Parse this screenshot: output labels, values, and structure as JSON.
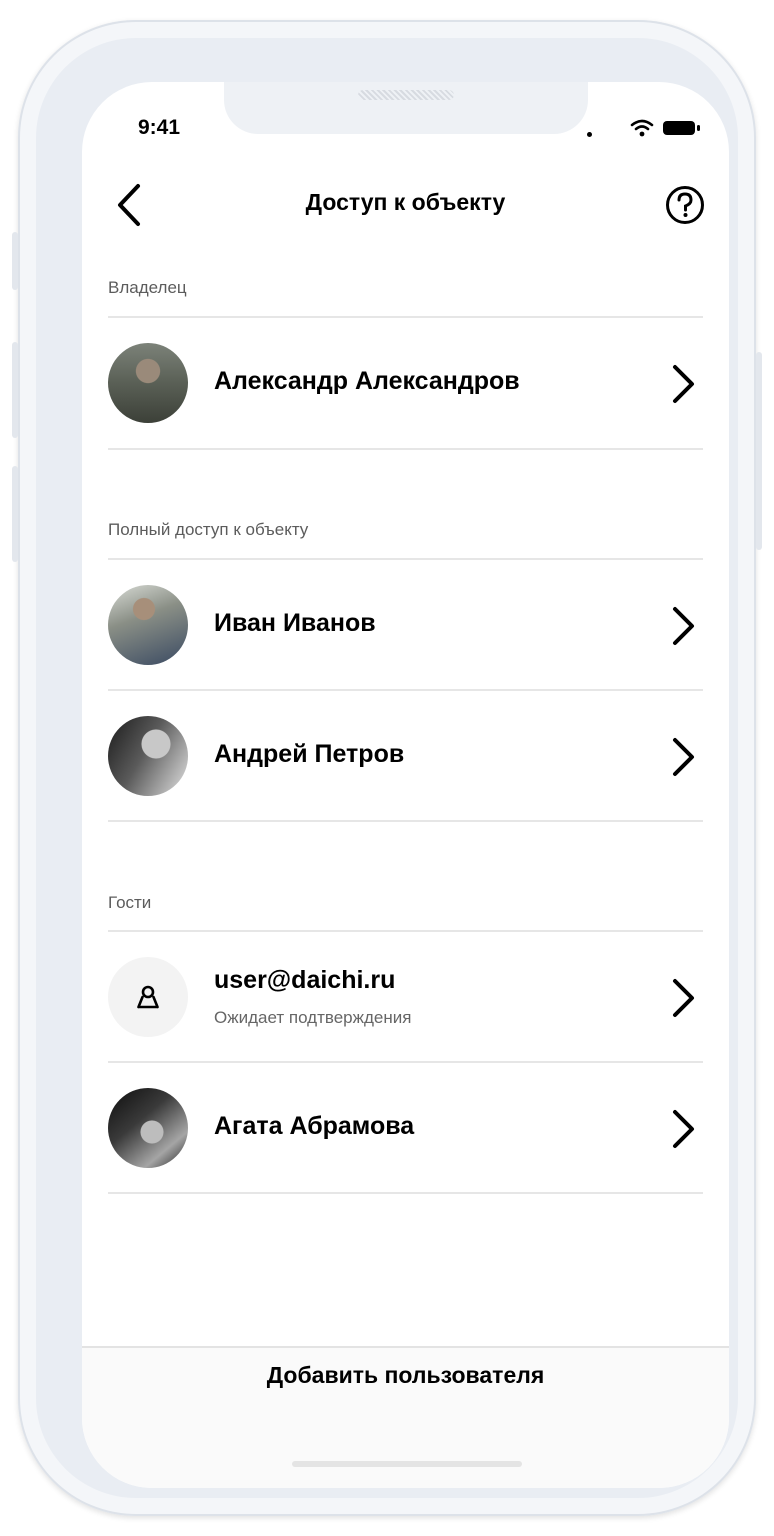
{
  "status_bar": {
    "time": "9:41"
  },
  "header": {
    "title": "Доступ к объекту"
  },
  "sections": {
    "owner": {
      "label": "Владелец"
    },
    "full_access": {
      "label": "Полный доступ к объекту"
    },
    "guests": {
      "label": "Гости"
    }
  },
  "users": {
    "owner": {
      "name": "Александр Александров"
    },
    "full1": {
      "name": "Иван Иванов"
    },
    "full2": {
      "name": "Андрей Петров"
    },
    "guest1": {
      "name": "user@daichi.ru",
      "status": "Ожидает подтверждения"
    },
    "guest2": {
      "name": "Агата Абрамова"
    }
  },
  "footer": {
    "add_user_label": "Добавить пользователя"
  },
  "colors": {
    "text": "#000000",
    "secondary": "#5c5c5c",
    "divider": "#e6e6e6"
  }
}
